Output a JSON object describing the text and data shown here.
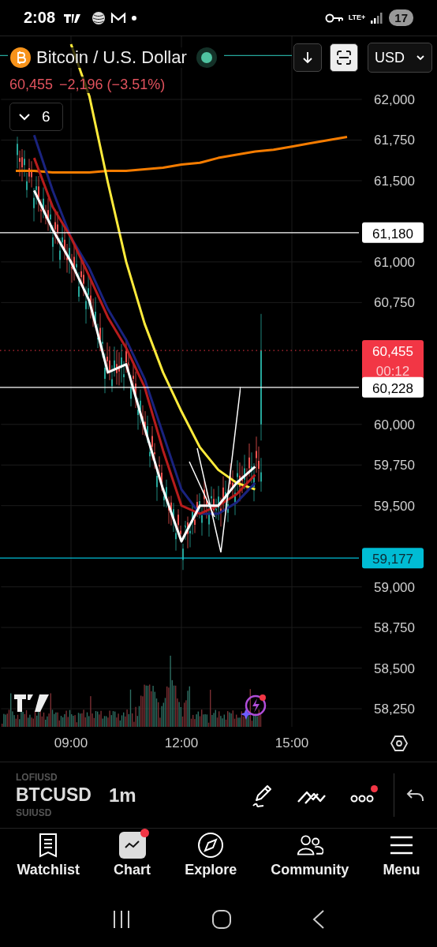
{
  "status_bar": {
    "time": "2:08",
    "network": "LTE+",
    "battery": "17"
  },
  "header": {
    "title": "Bitcoin / U.S. Dollar",
    "live": true,
    "price": "60,455",
    "change": "−2,196 (−3.51%)",
    "falling": true,
    "indicators_count": "6",
    "currency": "USD"
  },
  "chart": {
    "chart_data": {
      "type": "line",
      "x": [
        7.5,
        8,
        8.5,
        9,
        9.5,
        10,
        10.5,
        11,
        11.5,
        12,
        12.5,
        13,
        13.5,
        14,
        14.5,
        15,
        15.5,
        16,
        16.5
      ],
      "xlim": [
        7.1,
        16.9
      ],
      "grid": true,
      "xticks": [
        {
          "value": 9,
          "label": "09:00"
        },
        {
          "value": 12,
          "label": "12:00"
        },
        {
          "value": 15,
          "label": "15:00"
        }
      ],
      "ylim": [
        58150,
        62380
      ],
      "yticks": [
        {
          "value": 62000,
          "label": "62,000"
        },
        {
          "value": 61750,
          "label": "61,750"
        },
        {
          "value": 61500,
          "label": "61,500"
        },
        {
          "value": 61000,
          "label": "61,000"
        },
        {
          "value": 60750,
          "label": "60,750"
        },
        {
          "value": 60000,
          "label": "60,000"
        },
        {
          "value": 59750,
          "label": "59,750"
        },
        {
          "value": 59500,
          "label": "59,500"
        },
        {
          "value": 59000,
          "label": "59,000"
        },
        {
          "value": 58750,
          "label": "58,750"
        },
        {
          "value": 58500,
          "label": "58,500"
        },
        {
          "value": 58250,
          "label": "58,250"
        }
      ],
      "series": [
        {
          "color": "#f57c00",
          "values": [
            61560,
            61560,
            61550,
            61550,
            61550,
            61560,
            61560,
            61570,
            61580,
            61600,
            61610,
            61640,
            61660,
            61680,
            61690,
            61710,
            61730,
            61750,
            61770
          ]
        },
        {
          "color": "#ffeb3b",
          "values": [
            null,
            null,
            null,
            62340,
            62020,
            61490,
            61000,
            60620,
            60320,
            60080,
            59860,
            59720,
            59640,
            59600,
            null,
            null,
            null,
            null,
            null
          ]
        },
        {
          "color": "#1a237e",
          "values": [
            null,
            61780,
            61440,
            61150,
            60960,
            60710,
            60520,
            60280,
            59940,
            59600,
            59450,
            59450,
            59520,
            59640,
            null,
            null,
            null,
            null,
            null
          ]
        },
        {
          "color": "#b71c1c",
          "values": [
            null,
            61640,
            61340,
            61150,
            60910,
            60660,
            60470,
            60230,
            59840,
            59500,
            59450,
            59500,
            59570,
            59690,
            null,
            null,
            null,
            null,
            null
          ]
        },
        {
          "color": "#ffffff",
          "values": [
            null,
            61440,
            61200,
            61000,
            60760,
            60320,
            60370,
            59980,
            59600,
            59280,
            59500,
            59500,
            59640,
            59740,
            null,
            null,
            null,
            null,
            null
          ]
        }
      ],
      "ref_lines": [
        {
          "axis": "y",
          "value": 62270,
          "color": "#26a69a"
        },
        {
          "axis": "y",
          "value": 61180,
          "label": "61,180",
          "color": "#ffffff"
        },
        {
          "axis": "y",
          "value": 60455,
          "label": "60,455",
          "color": "#f23645"
        },
        {
          "axis": "y",
          "value": 60228,
          "label": "60,228",
          "color": "#ffffff"
        },
        {
          "axis": "y",
          "value": 59177,
          "label": "59,177",
          "color": "#00bcd4"
        }
      ]
    },
    "countdown": "00:12"
  },
  "toolbar": {
    "symbols": [
      {
        "label": "LOFIUSD",
        "selected": false
      },
      {
        "label": "BTCUSD",
        "selected": true
      },
      {
        "label": "SUIUSD",
        "selected": false
      }
    ],
    "interval": "1m",
    "tools": [
      {
        "kind": "draw"
      },
      {
        "kind": "lines"
      },
      {
        "kind": "more",
        "badge": true
      },
      {
        "kind": "undo"
      }
    ]
  },
  "nav": [
    {
      "label": "Watchlist",
      "kind": "watchlist",
      "selected": false,
      "badge": false
    },
    {
      "label": "Chart",
      "kind": "chart",
      "selected": true,
      "badge": true
    },
    {
      "label": "Explore",
      "kind": "explore",
      "selected": false,
      "badge": false
    },
    {
      "label": "Community",
      "kind": "community",
      "selected": false,
      "badge": false
    },
    {
      "label": "Menu",
      "kind": "menu",
      "selected": false,
      "badge": false
    }
  ]
}
